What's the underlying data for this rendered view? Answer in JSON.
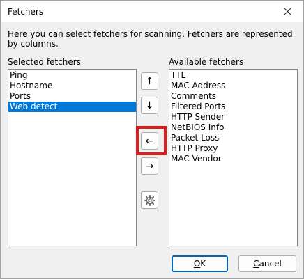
{
  "window": {
    "title": "Fetchers"
  },
  "description": "Here you can select fetchers for scanning. Fetchers are represented by columns.",
  "selected": {
    "label": "Selected fetchers",
    "items": [
      {
        "label": "Ping",
        "selected": false
      },
      {
        "label": "Hostname",
        "selected": false
      },
      {
        "label": "Ports",
        "selected": false
      },
      {
        "label": "Web detect",
        "selected": true
      }
    ]
  },
  "available": {
    "label": "Available fetchers",
    "items": [
      "TTL",
      "MAC Address",
      "Comments",
      "Filtered Ports",
      "HTTP Sender",
      "NetBIOS Info",
      "Packet Loss",
      "HTTP Proxy",
      "MAC Vendor"
    ]
  },
  "controls": {
    "move_up": "↑",
    "move_down": "↓",
    "add_left": "←",
    "remove_right": "→"
  },
  "buttons": {
    "ok_mnemonic": "O",
    "ok_rest": "K",
    "cancel_mnemonic": "C",
    "cancel_rest": "ancel"
  },
  "colors": {
    "selection": "#0078d7",
    "highlight": "#e31b1b"
  }
}
